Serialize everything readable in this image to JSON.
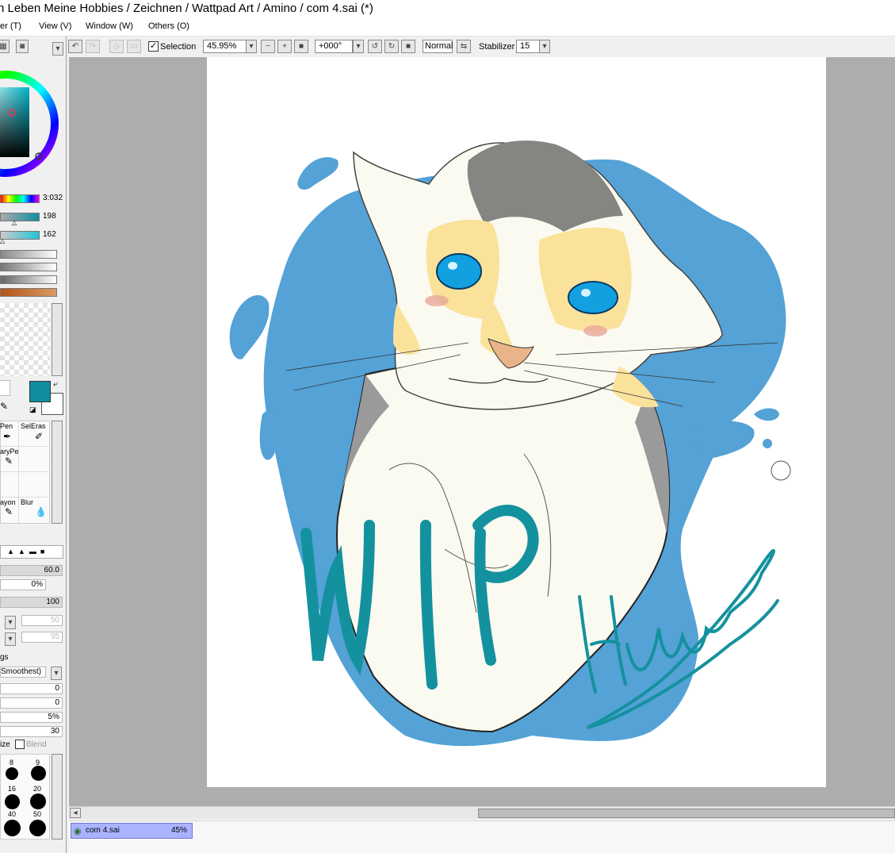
{
  "window": {
    "title": "n Leben Meine Hobbies / Zeichnen / Wattpad Art / Amino / com 4.sai (*)"
  },
  "menu": {
    "items": [
      "er (T)",
      "View (V)",
      "Window (W)",
      "Others (O)"
    ]
  },
  "toolbar": {
    "selection_label": "Selection",
    "selection_checked": true,
    "zoom": "45.95%",
    "rotation": "+000°",
    "blend_mode": "Normal",
    "stabilizer_label": "Stabilizer",
    "stabilizer_value": "15"
  },
  "color_panel": {
    "hue_value": "3:032",
    "sat_value": "198",
    "val_value": "162",
    "primary_color": "#118ea0",
    "secondary_color": "#ffffff"
  },
  "tools": {
    "pen": "Pen",
    "selection_eraser": "SelEras",
    "binary_pen": "aryPe",
    "crayon": "ayon",
    "blur": "Blur"
  },
  "brush_settings": {
    "size_value": "60.0",
    "min_size": "0%",
    "density": "100",
    "texture_value": "50",
    "edge_value": "95",
    "settings_label": "gs",
    "smoothing": "Smoothest)",
    "val1": "0",
    "val2": "0",
    "val3": "5%",
    "val4": "30",
    "size_label": "ize",
    "blend_label": "Blend",
    "brush_sizes": [
      "8",
      "9",
      "16",
      "20",
      "40",
      "50"
    ]
  },
  "document_tab": {
    "name": "com 4.sai",
    "zoom": "45%"
  },
  "artwork": {
    "handwritten_text": "WIP",
    "signature": "Hunders"
  }
}
